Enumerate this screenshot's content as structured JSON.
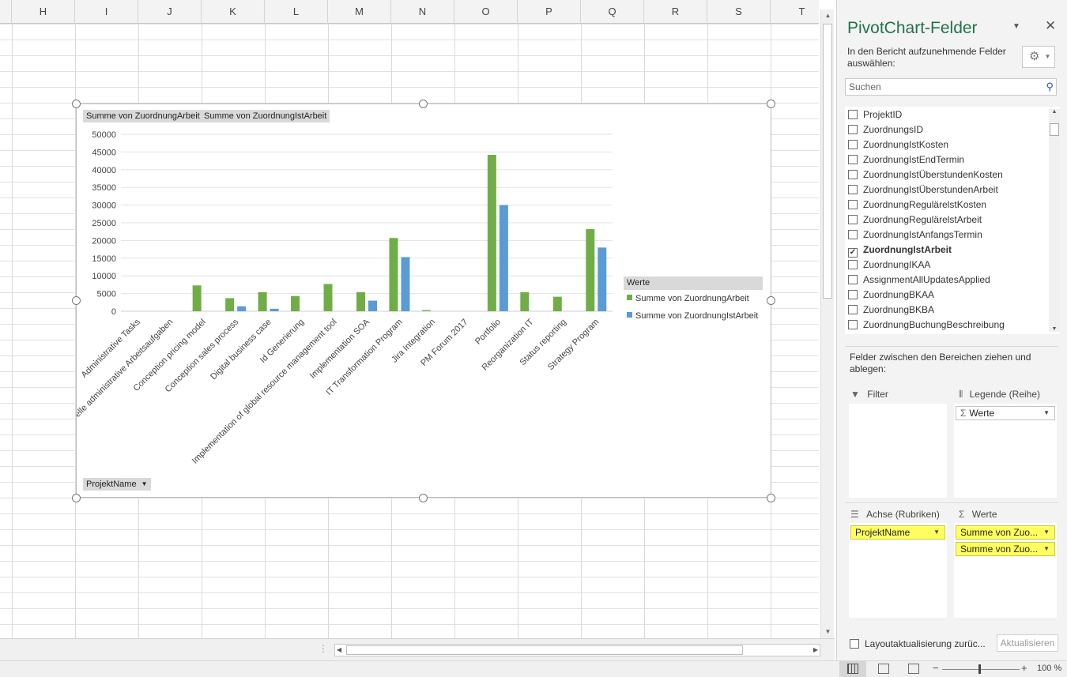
{
  "sheet": {
    "columns": [
      "H",
      "I",
      "J",
      "K",
      "L",
      "M",
      "N",
      "O",
      "P",
      "Q",
      "R",
      "S",
      "T"
    ]
  },
  "chart": {
    "value_buttons": [
      "Summe  von ZuordnungArbeit",
      "Summe  von ZuordnungIstArbeit"
    ],
    "axis_button": "ProjektName",
    "legend_title": "Werte"
  },
  "chart_data": {
    "type": "bar",
    "categories": [
      "Administrative Tasks",
      "Generelle administrative Arbeitsaufgaben",
      "Conception pricing model",
      "Conception sales process",
      "Digital business case",
      "Id Generierung",
      "Implementation of global resource management tool",
      "Implementation SOA",
      "IT Transformation Program",
      "Jira Integration",
      "PM Forum 2017",
      "Portfolio",
      "Reorganization IT",
      "Status reporting",
      "Strategy Program"
    ],
    "series": [
      {
        "name": "Summe von ZuordnungArbeit",
        "color": "#70ad47",
        "values": [
          0,
          0,
          7300,
          3700,
          5400,
          4300,
          7700,
          5400,
          20700,
          300,
          0,
          44200,
          5400,
          4100,
          23200
        ]
      },
      {
        "name": "Summe von ZuordnungIstArbeit",
        "color": "#5b9bd5",
        "values": [
          0,
          0,
          0,
          1400,
          700,
          0,
          0,
          3000,
          15300,
          0,
          0,
          30000,
          0,
          0,
          18000
        ]
      }
    ],
    "yticks": [
      "50000",
      "45000",
      "40000",
      "35000",
      "30000",
      "25000",
      "20000",
      "15000",
      "10000",
      "5000",
      "0"
    ],
    "ylim": [
      0,
      50000
    ],
    "grid": true,
    "legend": "right"
  },
  "panel": {
    "title": "PivotChart-Felder",
    "instruction": "In den Bericht aufzunehmende Felder auswählen:",
    "search_placeholder": "Suchen",
    "fields": [
      {
        "label": "ProjektID",
        "checked": false
      },
      {
        "label": "ZuordnungsID",
        "checked": false
      },
      {
        "label": "ZuordnungIstKosten",
        "checked": false
      },
      {
        "label": "ZuordnungIstEndTermin",
        "checked": false
      },
      {
        "label": "ZuordnungIstÜberstundenKosten",
        "checked": false
      },
      {
        "label": "ZuordnungIstÜberstundenArbeit",
        "checked": false
      },
      {
        "label": "ZuordnungRegulärelstKosten",
        "checked": false
      },
      {
        "label": "ZuordnungRegulärelstArbeit",
        "checked": false
      },
      {
        "label": "ZuordnungIstAnfangsTermin",
        "checked": false
      },
      {
        "label": "ZuordnungIstArbeit",
        "checked": true
      },
      {
        "label": "ZuordnungIKAA",
        "checked": false
      },
      {
        "label": "AssignmentAllUpdatesApplied",
        "checked": false
      },
      {
        "label": "ZuordnungBKAA",
        "checked": false
      },
      {
        "label": "ZuordnungBKBA",
        "checked": false
      },
      {
        "label": "ZuordnungBuchungBeschreibung",
        "checked": false
      }
    ],
    "drag_instruction": "Felder zwischen den Bereichen ziehen und ablegen:",
    "areas": {
      "filter": {
        "label": "Filter"
      },
      "legend": {
        "label": "Legende (Reihe)",
        "items": [
          "Werte"
        ]
      },
      "axis": {
        "label": "Achse (Rubriken)",
        "items": [
          "ProjektName"
        ]
      },
      "values": {
        "label": "Werte",
        "items": [
          "Summe von Zuo...",
          "Summe von Zuo..."
        ]
      }
    },
    "defer_label": "Layoutaktualisierung zurüc...",
    "update_button": "Aktualisieren"
  },
  "statusbar": {
    "zoom": "100 %"
  }
}
